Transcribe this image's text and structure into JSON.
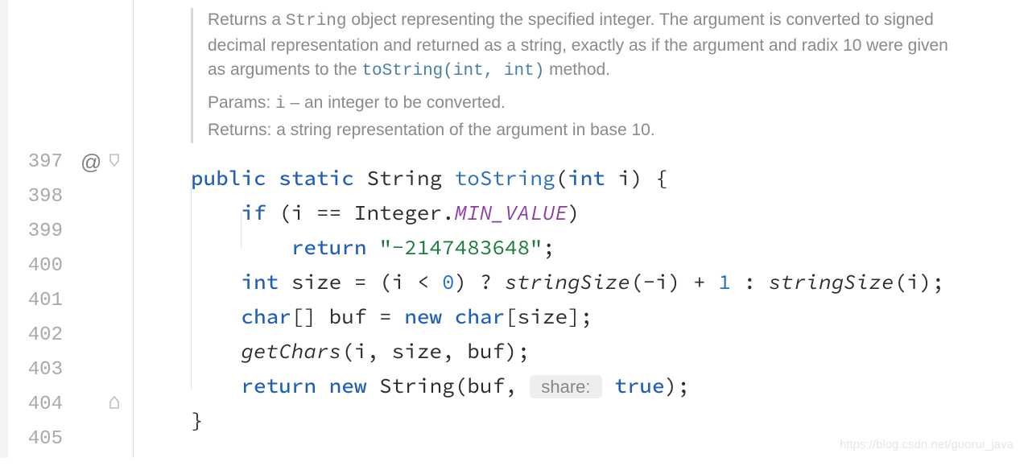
{
  "doc": {
    "desc_before_code1": "Returns a ",
    "code1": "String",
    "desc_after_code1": " object representing the specified integer. The argument is converted to signed decimal representation and returned as a string, exactly as if the argument and radix 10 were given as arguments to the ",
    "link": "toString(int, int)",
    "desc_after_link": " method.",
    "params_label": "Params:",
    "param_name": "i",
    "param_dash": " – ",
    "param_desc": "an integer to be converted.",
    "returns_label": "Returns:",
    "returns_desc": "a string representation of the argument in base 10."
  },
  "lines": {
    "n397": "397",
    "n398": "398",
    "n399": "399",
    "n400": "400",
    "n401": "401",
    "n402": "402",
    "n403": "403",
    "n404": "404",
    "n405": "405"
  },
  "gutter": {
    "at": "@"
  },
  "code": {
    "l397": {
      "kw_public": "public",
      "kw_static": "static",
      "type": "String",
      "mname": "toString",
      "open": "(",
      "kw_int": "int",
      "param": " i) {"
    },
    "l398": {
      "kw_if": "if",
      "rest1": " (i == Integer.",
      "const": "MIN_VALUE",
      "rest2": ")"
    },
    "l399": {
      "kw_return": "return",
      "sp": " ",
      "str": "\"-2147483648\"",
      "semi": ";"
    },
    "l400": {
      "kw_int": "int",
      "t1": " size = (i < ",
      "num": "0",
      "t2": ") ? ",
      "fn1": "stringSize",
      "t3": "(-i) + ",
      "one": "1",
      "t4": " : ",
      "fn2": "stringSize",
      "t5": "(i);"
    },
    "l401": {
      "kw_char": "char",
      "t1": "[] buf = ",
      "kw_new": "new",
      "sp": " ",
      "kw_char2": "char",
      "t2": "[size];"
    },
    "l402": {
      "fn": "getChars",
      "t": "(i, size, buf);"
    },
    "l403": {
      "kw_return": "return",
      "sp": " ",
      "kw_new": "new",
      "t1": " String(buf, ",
      "hint": " share: ",
      "kw_true": "true",
      "t2": ");"
    },
    "l404": {
      "brace": "}"
    }
  },
  "watermark": "https://blog.csdn.net/guorui_java"
}
